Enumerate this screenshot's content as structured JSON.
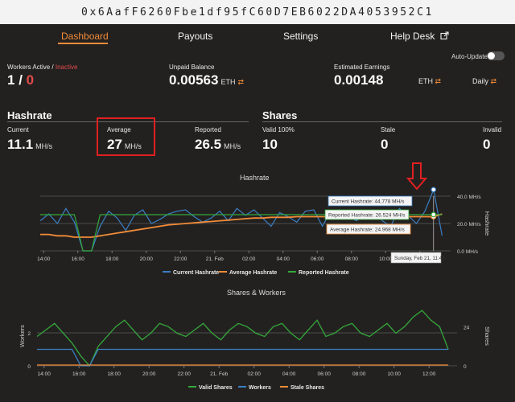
{
  "address": "0x6AafF6260Fbe1df95fC60D7EB6022DA4053952C1",
  "nav": {
    "dashboard": "Dashboard",
    "payouts": "Payouts",
    "settings": "Settings",
    "helpdesk": "Help Desk"
  },
  "auto_update": {
    "label": "Auto-Update",
    "enabled": false
  },
  "workers": {
    "label_active": "Workers Active / ",
    "label_inactive": "Inactive",
    "active": "1",
    "separator": " / ",
    "inactive": "0"
  },
  "unpaid": {
    "label": "Unpaid Balance",
    "value": "0.00563",
    "unit": "ETH",
    "swap": "⇄"
  },
  "earnings": {
    "label": "Estimated Earnings",
    "value": "0.00148",
    "unit": "ETH",
    "period": "Daily",
    "swap": "⇄"
  },
  "hashrate": {
    "title": "Hashrate",
    "current_label": "Current",
    "current_value": "11.1",
    "current_unit": "MH/s",
    "average_label": "Average",
    "average_value": "27",
    "average_unit": "MH/s",
    "reported_label": "Reported",
    "reported_value": "26.5",
    "reported_unit": "MH/s"
  },
  "shares": {
    "title": "Shares",
    "valid_label": "Valid 100%",
    "valid_value": "10",
    "stale_label": "Stale",
    "stale_value": "0",
    "invalid_label": "Invalid",
    "invalid_value": "0"
  },
  "colors": {
    "accent": "#f28c38",
    "inactive": "#e24b4b",
    "current": "#3a7fc4",
    "average": "#f28c38",
    "reported": "#34a83a",
    "valid": "#34a83a",
    "workers": "#3a7fc4",
    "stale": "#f28c38",
    "highlight": "#e02020"
  },
  "chart_data": [
    {
      "type": "line",
      "title": "Hashrate",
      "ylabel": "Hashrate",
      "ylim": [
        0,
        40
      ],
      "x_ticks": [
        "14:00",
        "16:00",
        "18:00",
        "20:00",
        "22:00",
        "21. Feb",
        "02:00",
        "04:00",
        "06:00",
        "08:00",
        "10:00",
        "12:00"
      ],
      "y_ticks": [
        "0.0 MH/s",
        "20.0 MH/s",
        "40.0 MH/s"
      ],
      "x": [
        0,
        0.5,
        1,
        1.5,
        2,
        2.5,
        3,
        3.5,
        4,
        4.5,
        5,
        5.5,
        6,
        6.5,
        7,
        7.5,
        8,
        8.5,
        9,
        9.5,
        10,
        10.5,
        11,
        11.5,
        12,
        12.5,
        13,
        13.5,
        14,
        14.5,
        15,
        15.5,
        16,
        16.5,
        17,
        17.5,
        18,
        18.5,
        19,
        19.5,
        20,
        20.5,
        21,
        21.5,
        22,
        22.5,
        23,
        23.5
      ],
      "series": [
        {
          "name": "Current Hashrate",
          "values": [
            22,
            27,
            20,
            31,
            21,
            0,
            0,
            18,
            29,
            24,
            15,
            26,
            30,
            20,
            23,
            27,
            29,
            30,
            25,
            21,
            24,
            29,
            22,
            31,
            26,
            30,
            24,
            18,
            28,
            25,
            21,
            29,
            30,
            18,
            29,
            30,
            25,
            22,
            27,
            30,
            22,
            18,
            31,
            26,
            20,
            29,
            44.778,
            11.1
          ]
        },
        {
          "name": "Average Hashrate",
          "values": [
            12,
            12,
            11,
            11,
            10,
            10,
            10,
            11,
            12,
            13,
            14,
            15,
            16,
            17,
            18,
            19,
            19.5,
            20,
            20.5,
            21,
            21.5,
            22,
            22.5,
            23,
            23.5,
            24,
            24,
            24.5,
            24.5,
            24.5,
            25,
            25,
            25,
            25,
            25,
            25,
            25,
            25,
            25,
            25,
            25,
            25,
            25,
            25,
            25,
            25,
            24.968,
            27
          ]
        },
        {
          "name": "Reported Hashrate",
          "values": [
            26.5,
            26.5,
            26.5,
            26.5,
            26.5,
            0,
            0,
            26.5,
            26.5,
            26.5,
            26.5,
            26.5,
            26.5,
            26.5,
            26.5,
            26.5,
            26.5,
            26.5,
            26.5,
            26.5,
            26.5,
            26.5,
            26.5,
            26.5,
            26.5,
            26.5,
            26.5,
            26.5,
            26.5,
            26.5,
            26.5,
            26.5,
            26.5,
            26.5,
            26.5,
            26.5,
            26.5,
            26.5,
            26.5,
            26.5,
            26.5,
            26.5,
            26.5,
            26.5,
            26.5,
            26.5,
            26.524,
            26.5
          ]
        }
      ],
      "tooltip": {
        "current": "Current Hashrate: 44.778 MH/s",
        "reported": "Reported Hashrate: 26.524 MH/s",
        "average": "Average Hashrate: 24.968 MH/s",
        "date": "Sunday, Feb 21, 11:40"
      },
      "legend_position": "bottom-center",
      "grid": true
    },
    {
      "type": "line",
      "title": "Shares & Workers",
      "ylabel": "Workers",
      "y2label": "Shares",
      "ylim": [
        0,
        2
      ],
      "y2lim": [
        0,
        36
      ],
      "x_ticks": [
        "14:00",
        "16:00",
        "18:00",
        "20:00",
        "22:00",
        "21. Feb",
        "02:00",
        "04:00",
        "06:00",
        "08:00",
        "10:00",
        "12:00"
      ],
      "y_ticks": [
        "0",
        "2"
      ],
      "y2_ticks": [
        "0",
        "24"
      ],
      "x": [
        0,
        0.5,
        1,
        1.5,
        2,
        2.5,
        3,
        3.5,
        4,
        4.5,
        5,
        5.5,
        6,
        6.5,
        7,
        7.5,
        8,
        8.5,
        9,
        9.5,
        10,
        10.5,
        11,
        11.5,
        12,
        12.5,
        13,
        13.5,
        14,
        14.5,
        15,
        15.5,
        16,
        16.5,
        17,
        17.5,
        18,
        18.5,
        19,
        19.5,
        20,
        20.5,
        21,
        21.5,
        22,
        22.5,
        23,
        23.5
      ],
      "series": [
        {
          "name": "Valid Shares",
          "values": [
            18,
            22,
            26,
            20,
            14,
            6,
            0,
            12,
            18,
            24,
            28,
            22,
            16,
            20,
            26,
            24,
            20,
            18,
            22,
            26,
            20,
            16,
            22,
            26,
            24,
            20,
            18,
            24,
            26,
            20,
            16,
            22,
            28,
            18,
            20,
            24,
            26,
            20,
            18,
            22,
            26,
            20,
            24,
            30,
            34,
            28,
            24,
            10
          ]
        },
        {
          "name": "Workers",
          "values": [
            1,
            1,
            1,
            1,
            1,
            0,
            0,
            1,
            1,
            1,
            1,
            1,
            1,
            1,
            1,
            1,
            1,
            1,
            1,
            1,
            1,
            1,
            1,
            1,
            1,
            1,
            1,
            1,
            1,
            1,
            1,
            1,
            1,
            1,
            1,
            1,
            1,
            1,
            1,
            1,
            1,
            1,
            1,
            1,
            1,
            1,
            1,
            1
          ]
        },
        {
          "name": "Stale Shares",
          "values": [
            0,
            0,
            0,
            0,
            0,
            0,
            0,
            0,
            0,
            0,
            0,
            0,
            0,
            0,
            0,
            0,
            0,
            0,
            0,
            0,
            0,
            0,
            0,
            0,
            0,
            0,
            0,
            0,
            0,
            0,
            0,
            0,
            0,
            0,
            0,
            0,
            0,
            0,
            0,
            0,
            0,
            0,
            0,
            0,
            0,
            0,
            0,
            0
          ]
        }
      ],
      "legend_position": "bottom-center",
      "grid": true
    }
  ]
}
